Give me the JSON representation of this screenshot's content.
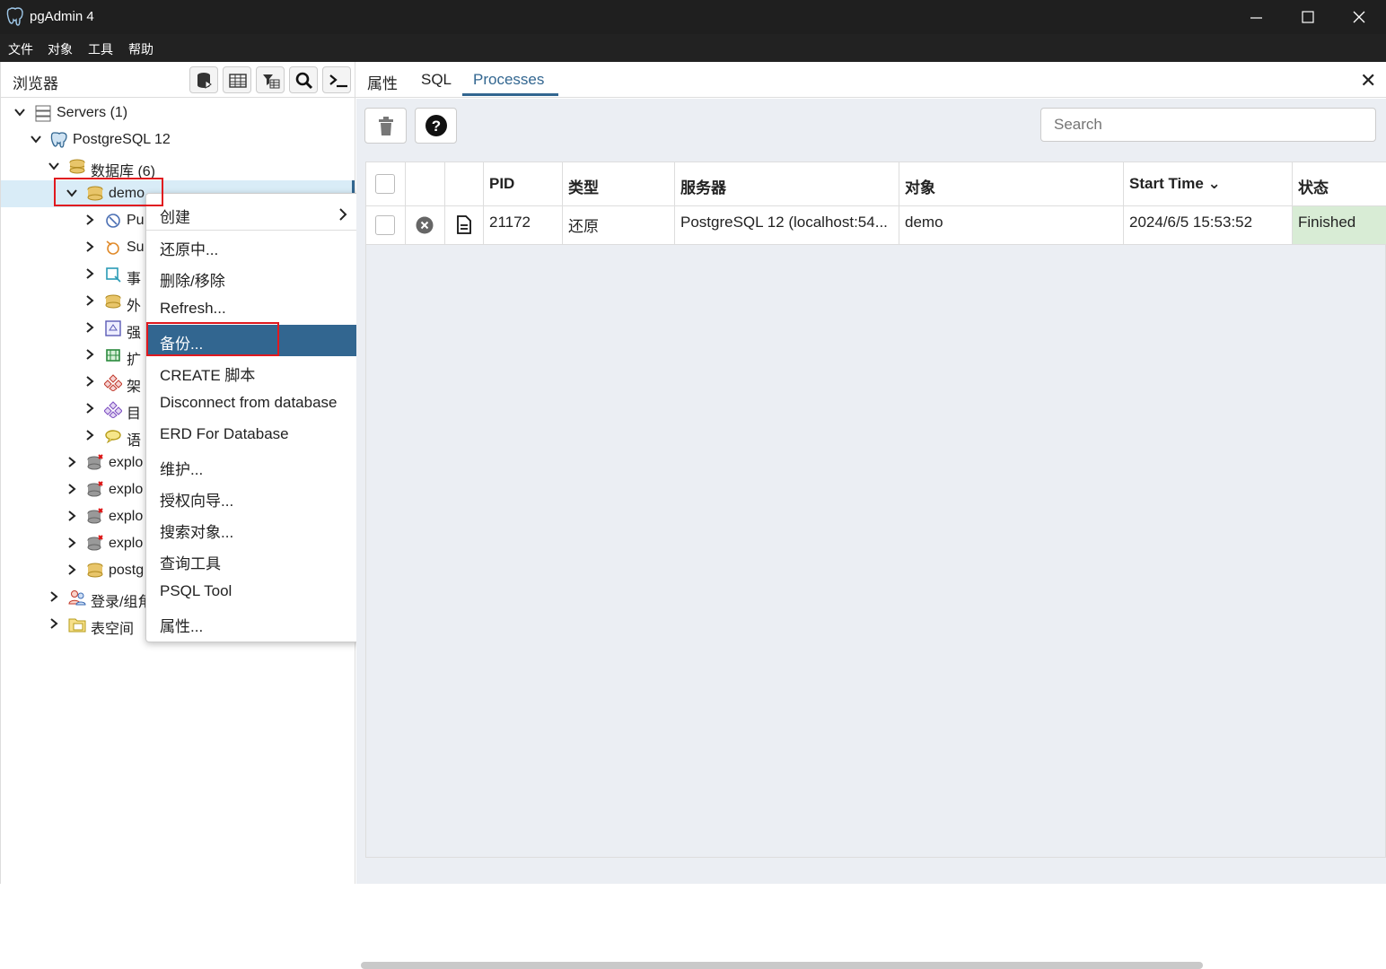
{
  "window": {
    "title": "pgAdmin 4",
    "bg_color": "#1f1f1f"
  },
  "menubar": {
    "items": [
      "文件",
      "对象",
      "工具",
      "帮助"
    ]
  },
  "browser": {
    "title": "浏览器",
    "tree": [
      {
        "label": "Servers (1)",
        "icon": "servers-icon",
        "expanded": true
      },
      {
        "label": "PostgreSQL 12",
        "icon": "postgres-elephant-icon",
        "expanded": true
      },
      {
        "label": "数据库 (6)",
        "icon": "databases-icon",
        "expanded": true
      },
      {
        "label": "demo",
        "icon": "database-icon",
        "expanded": true,
        "selected": true
      },
      {
        "label": "Pu",
        "icon": "publication-icon"
      },
      {
        "label": "Su",
        "icon": "subscription-icon"
      },
      {
        "label": "事",
        "icon": "event-trigger-icon"
      },
      {
        "label": "外",
        "icon": "foreign-data-icon"
      },
      {
        "label": "强",
        "icon": "cast-icon"
      },
      {
        "label": "扩",
        "icon": "extension-icon"
      },
      {
        "label": "架",
        "icon": "schema-icon"
      },
      {
        "label": "目",
        "icon": "catalog-icon"
      },
      {
        "label": "语",
        "icon": "language-icon"
      },
      {
        "label": "explo",
        "icon": "database-disconnected-icon"
      },
      {
        "label": "explo",
        "icon": "database-disconnected-icon"
      },
      {
        "label": "explo",
        "icon": "database-disconnected-icon"
      },
      {
        "label": "explo",
        "icon": "database-disconnected-icon"
      },
      {
        "label": "postg",
        "icon": "database-icon"
      },
      {
        "label": "登录/组角",
        "icon": "login-roles-icon"
      },
      {
        "label": "表空间",
        "icon": "tablespace-icon"
      }
    ]
  },
  "context_menu": {
    "items": [
      {
        "label": "创建",
        "submenu": true
      },
      {
        "label": "还原中..."
      },
      {
        "label": "删除/移除"
      },
      {
        "label": "Refresh..."
      },
      {
        "label": "备份...",
        "active": true
      },
      {
        "label": "CREATE 脚本"
      },
      {
        "label": "Disconnect from database"
      },
      {
        "label": "ERD For Database"
      },
      {
        "label": "维护..."
      },
      {
        "label": "授权向导..."
      },
      {
        "label": "搜索对象..."
      },
      {
        "label": "查询工具"
      },
      {
        "label": "PSQL Tool"
      },
      {
        "label": "属性..."
      }
    ],
    "active_color": "#326690"
  },
  "right_panel": {
    "tabs": [
      "属性",
      "SQL",
      "Processes"
    ],
    "active_tab": "Processes",
    "close_label": "✕",
    "search_placeholder": "Search",
    "table": {
      "headers": [
        "PID",
        "类型",
        "服务器",
        "对象",
        "Start Time ⌄",
        "状态"
      ],
      "rows": [
        {
          "pid": "21172",
          "type": "还原",
          "server": "PostgreSQL 12 (localhost:54...",
          "object": "demo",
          "start_time": "2024/6/5 15:53:52",
          "status": "Finished"
        }
      ]
    },
    "status_finished_color": "#d8ecd5"
  },
  "highlight_color": "#e0191f"
}
